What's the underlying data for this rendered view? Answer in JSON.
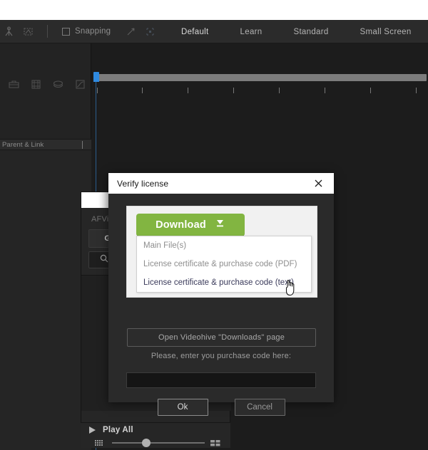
{
  "app": {
    "toolbar": {
      "snapping_label": "Snapping",
      "icons": [
        "anchor-point-icon",
        "mask-shape-icon",
        "snapping-link-icon",
        "region-of-interest-icon"
      ],
      "workspace_tabs": [
        {
          "label": "Default",
          "selected": true
        },
        {
          "label": "Learn",
          "selected": false
        },
        {
          "label": "Standard",
          "selected": false
        },
        {
          "label": "Small Screen",
          "selected": false
        }
      ]
    },
    "left_panel": {
      "column_header": "Parent & Link",
      "layer_icons": [
        "toolbox-icon",
        "film-strip-icon",
        "shy-layers-icon",
        "graph-editor-icon"
      ]
    },
    "background_panel": {
      "title": "AFVi…",
      "go_button": "Go",
      "search_icon": "search-icon"
    },
    "play_strip": {
      "play_label": "Play All",
      "play_icon": "play-triangle-icon",
      "left_icon": "grid-small-icon",
      "right_icon": "grid-large-icon",
      "slider_value": 32
    }
  },
  "dialog": {
    "title": "Verify license",
    "close_icon": "close-icon",
    "download": {
      "button_label": "Download",
      "button_icon": "download-arrow-icon",
      "button_color": "#82b541",
      "menu_items": [
        {
          "label": "Main File(s)",
          "highlighted": false
        },
        {
          "label": "License certificate & purchase code (PDF)",
          "highlighted": false
        },
        {
          "label": "License certificate & purchase code (text)",
          "highlighted": true
        }
      ]
    },
    "open_page_button": "Open Videohive \"Downloads\" page",
    "purchase_prompt": "Please, enter you purchase code here:",
    "purchase_input_value": "",
    "purchase_input_placeholder": "",
    "ok_button": "Ok",
    "cancel_button": "Cancel"
  },
  "cursor": {
    "icon": "pointing-hand-cursor"
  }
}
